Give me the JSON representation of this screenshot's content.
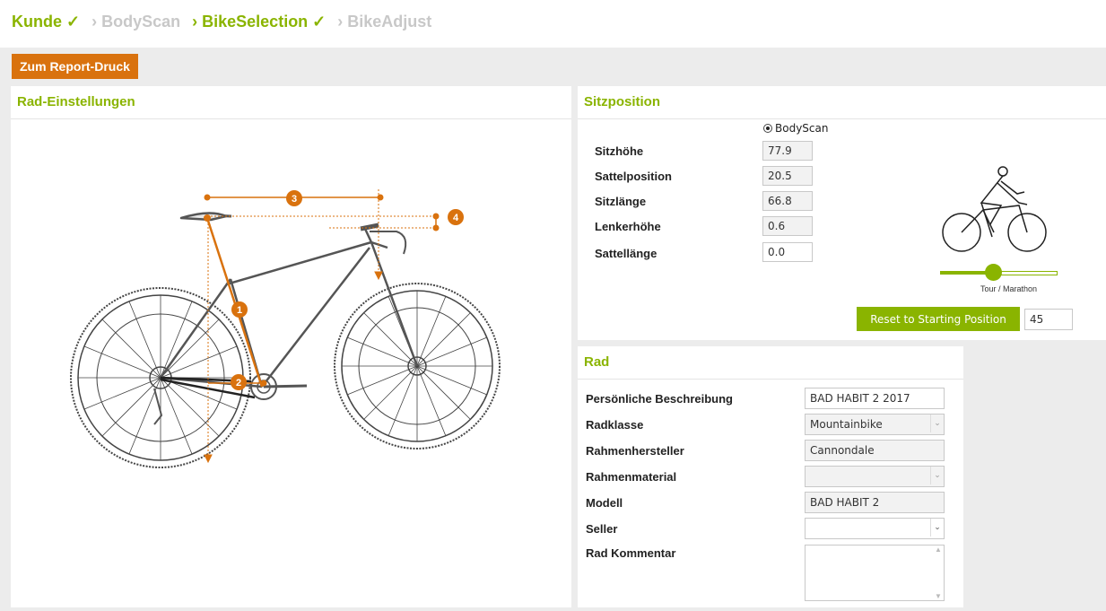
{
  "breadcrumbs": [
    {
      "label": "Kunde ✓",
      "state": "done"
    },
    {
      "label": "› BodyScan",
      "state": "todo"
    },
    {
      "label": "› BikeSelection ✓",
      "state": "done"
    },
    {
      "label": "› BikeAdjust",
      "state": "todo"
    }
  ],
  "toolbar": {
    "report_label": "Zum Report-Druck"
  },
  "bike_panel": {
    "title": "Rad-Einstellungen",
    "markers": [
      "1",
      "2",
      "3",
      "4"
    ]
  },
  "sitz_panel": {
    "title": "Sitzposition",
    "radio_label": "BodyScan",
    "rows": [
      {
        "label": "Sitzhöhe",
        "value": "77.9"
      },
      {
        "label": "Sattelposition",
        "value": "20.5"
      },
      {
        "label": "Sitzlänge",
        "value": "66.8"
      },
      {
        "label": "Lenkerhöhe",
        "value": "0.6"
      },
      {
        "label": "Sattellänge",
        "value": "0.0"
      }
    ],
    "slider_caption": "Tour / Marathon",
    "reset_label": "Reset to Starting Position",
    "reset_value": "45"
  },
  "rad_panel": {
    "title": "Rad",
    "rows": [
      {
        "label": "Persönliche Beschreibung",
        "value": "BAD HABIT 2 2017"
      },
      {
        "label": "Radklasse",
        "value": "Mountainbike"
      },
      {
        "label": "Rahmenhersteller",
        "value": "Cannondale"
      },
      {
        "label": "Rahmenmaterial",
        "value": ""
      },
      {
        "label": "Modell",
        "value": "BAD HABIT 2"
      },
      {
        "label": "Seller",
        "value": ""
      },
      {
        "label": "Rad Kommentar",
        "value": ""
      }
    ]
  },
  "colors": {
    "accent": "#8ab400",
    "orange": "#d9720e"
  }
}
